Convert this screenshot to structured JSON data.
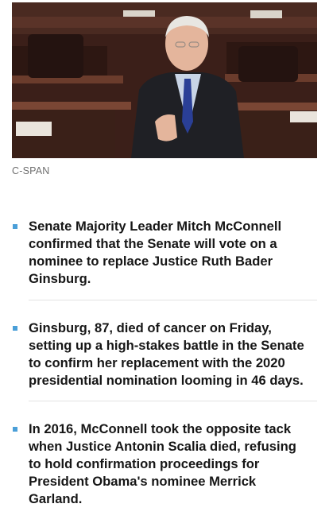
{
  "photo": {
    "alt": "Mitch McConnell speaking on the Senate floor"
  },
  "caption": "C-SPAN",
  "colors": {
    "bullet_marker": "#4a9fd8",
    "divider": "#e2e2e2",
    "caption": "#6f6f6f"
  },
  "bullets": [
    {
      "text": "Senate Majority Leader Mitch McConnell confirmed that the Senate will vote on a nominee to replace Justice Ruth Bader Ginsburg."
    },
    {
      "text": "Ginsburg, 87, died of cancer on Friday, setting up a high-stakes battle in the Senate to confirm her replacement with the 2020 presidential nomination looming in 46 days."
    },
    {
      "text": "In 2016, McConnell took the opposite tack when Justice Antonin Scalia died, refusing to hold confirmation proceedings for President Obama's nominee Merrick Garland."
    }
  ]
}
